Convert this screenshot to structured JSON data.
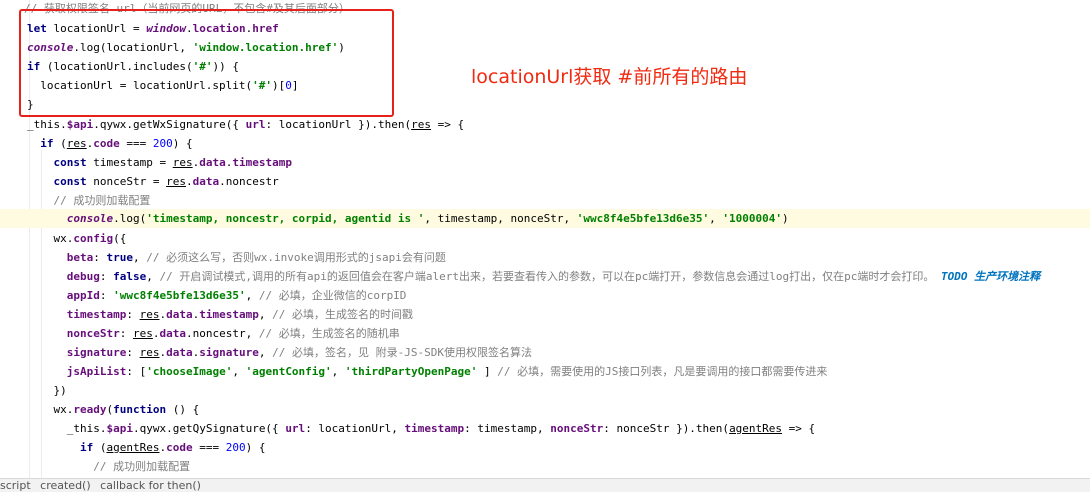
{
  "annotation": "locationUrl获取 #前所有的路由",
  "code": {
    "l0": "// 获取权限签名 url（当前网页的URL，不包含#及其后面部分）",
    "l1": [
      "let",
      " locationUrl = ",
      "window",
      ".",
      "location",
      ".",
      "href"
    ],
    "l2": [
      "console",
      ".log(locationUrl, ",
      "'window.location.href'",
      ")"
    ],
    "l3": [
      "if",
      " (locationUrl.includes(",
      "'#'",
      ")) {"
    ],
    "l4": [
      "  locationUrl = locationUrl.split(",
      "'#'",
      ")[",
      "0",
      "]"
    ],
    "l5": "}",
    "l6": [
      "_this.",
      "$api",
      ".qywx.getWxSignature({ ",
      "url",
      ": locationUrl }).then(",
      "res",
      " => {"
    ],
    "l7": [
      "  ",
      "if",
      " (",
      "res",
      ".",
      "code",
      " === ",
      "200",
      ") {"
    ],
    "l8": [
      "    ",
      "const",
      " timestamp = ",
      "res",
      ".",
      "data",
      ".",
      "timestamp"
    ],
    "l9": [
      "    ",
      "const",
      " nonceStr = ",
      "res",
      ".",
      "data",
      ".noncestr"
    ],
    "l10": "    // 成功则加载配置",
    "l11": [
      "      ",
      "console",
      ".log(",
      "'timestamp, noncestr, corpid, agentid is '",
      ", timestamp, nonceStr, ",
      "'wwc8f4e5bfe13d6e35'",
      ", ",
      "'1000004'",
      ")"
    ],
    "l12": [
      "    wx.",
      "config",
      "({"
    ],
    "l13": [
      "      ",
      "beta",
      ": ",
      "true",
      ", ",
      "// 必须这么写，否则wx.invoke调用形式的jsapi会有问题"
    ],
    "l14": [
      "      ",
      "debug",
      ": ",
      "false",
      ", ",
      "// 开启调试模式,调用的所有api的返回值会在客户端alert出来，若要查看传入的参数，可以在pc端打开，参数信息会通过log打出，仅在pc端时才会打印。",
      " TODO 生产环境注释"
    ],
    "l15": [
      "      ",
      "appId",
      ": ",
      "'wwc8f4e5bfe13d6e35'",
      ", ",
      "// 必填，企业微信的corpID"
    ],
    "l16": [
      "      ",
      "timestamp",
      ": ",
      "res",
      ".",
      "data",
      ".",
      "timestamp",
      ", ",
      "// 必填，生成签名的时间戳"
    ],
    "l17": [
      "      ",
      "nonceStr",
      ": ",
      "res",
      ".",
      "data",
      ".noncestr, ",
      "// 必填，生成签名的随机串"
    ],
    "l18": [
      "      ",
      "signature",
      ": ",
      "res",
      ".",
      "data",
      ".",
      "signature",
      ", ",
      "// 必填，签名，见 附录-JS-SDK使用权限签名算法"
    ],
    "l19": [
      "      ",
      "jsApiList",
      ": [",
      "'chooseImage'",
      ", ",
      "'agentConfig'",
      ", ",
      "'thirdPartyOpenPage'",
      " ] ",
      "// 必填，需要使用的JS接口列表，凡是要调用的接口都需要传进来"
    ],
    "l20": "    })",
    "l21": [
      "    wx.",
      "ready",
      "(",
      "function",
      " () {"
    ],
    "l22": [
      "      _this.",
      "$api",
      ".qywx.getQySignature({ ",
      "url",
      ": locationUrl, ",
      "timestamp",
      ": timestamp, ",
      "nonceStr",
      ": nonceStr }).then(",
      "agentRes",
      " => {"
    ],
    "l23": [
      "        ",
      "if",
      " (",
      "agentRes",
      ".",
      "code",
      " === ",
      "200",
      ") {"
    ],
    "l24": "          // 成功则加载配置"
  },
  "breadcrumb": [
    "script",
    "created()",
    "callback for then()"
  ]
}
